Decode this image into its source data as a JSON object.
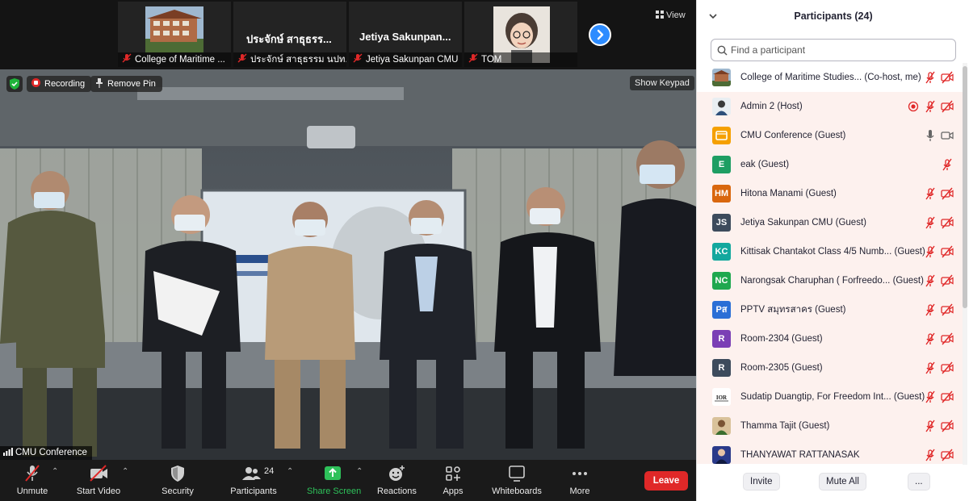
{
  "thumbnails": [
    {
      "name": "",
      "label": "College of Maritime ..."
    },
    {
      "name": "ประจักษ์ สาธุธรร...",
      "label": "ประจักษ์ สาธุธรรม นปท.เ..."
    },
    {
      "name": "Jetiya  Sakunpan...",
      "label": "Jetiya Sakunpan CMU"
    },
    {
      "name": "",
      "label": "TOM"
    }
  ],
  "top_controls": {
    "view_label": "View"
  },
  "overlay": {
    "recording_label": "Recording",
    "remove_pin_label": "Remove Pin",
    "show_keypad_label": "Show Keypad",
    "active_speaker": "CMU Conference"
  },
  "toolbar": {
    "unmute": "Unmute",
    "start_video": "Start Video",
    "security": "Security",
    "participants": "Participants",
    "participants_count": "24",
    "share_screen": "Share Screen",
    "reactions": "Reactions",
    "apps": "Apps",
    "whiteboards": "Whiteboards",
    "more": "More",
    "leave": "Leave"
  },
  "panel": {
    "title": "Participants (24)",
    "search_placeholder": "Find a participant",
    "invite": "Invite",
    "mute_all": "Mute All",
    "more": "..."
  },
  "participants": [
    {
      "name": "College of Maritime Studies...",
      "role": "(Co-host, me)",
      "avatar": "",
      "avatar_color": "#7a5a3a",
      "mic": "muted",
      "video": "off",
      "rec": false
    },
    {
      "name": "Admin 2",
      "role": "(Host)",
      "avatar": "",
      "avatar_color": "#c9d3de",
      "mic": "muted",
      "video": "off",
      "rec": true
    },
    {
      "name": "CMU Conference",
      "role": "(Guest)",
      "avatar": "",
      "avatar_color": "#f5a000",
      "mic": "on",
      "video": "on",
      "rec": false
    },
    {
      "name": "eak",
      "role": "(Guest)",
      "avatar": "E",
      "avatar_color": "#1e9e63",
      "mic": "muted",
      "video": "none",
      "rec": false
    },
    {
      "name": "Hitona Manami",
      "role": "(Guest)",
      "avatar": "HM",
      "avatar_color": "#d9670e",
      "mic": "muted",
      "video": "off",
      "rec": false
    },
    {
      "name": "Jetiya Sakunpan CMU",
      "role": "(Guest)",
      "avatar": "JS",
      "avatar_color": "#3d4b5c",
      "mic": "muted",
      "video": "off",
      "rec": false
    },
    {
      "name": "Kittisak Chantakot Class 4/5 Numb...",
      "role": "(Guest)",
      "avatar": "KC",
      "avatar_color": "#13a89e",
      "mic": "muted",
      "video": "off",
      "rec": false
    },
    {
      "name": "Narongsak Charuphan ( Forfreedo...",
      "role": "(Guest)",
      "avatar": "NC",
      "avatar_color": "#1fa84f",
      "mic": "muted",
      "video": "off",
      "rec": false
    },
    {
      "name": "PPTV สมุทรสาคร",
      "role": "(Guest)",
      "avatar": "Pส",
      "avatar_color": "#2a6fd6",
      "mic": "muted",
      "video": "off",
      "rec": false
    },
    {
      "name": "Room-2304",
      "role": "(Guest)",
      "avatar": "R",
      "avatar_color": "#7b3fb5",
      "mic": "muted",
      "video": "off",
      "rec": false
    },
    {
      "name": "Room-2305",
      "role": "(Guest)",
      "avatar": "R",
      "avatar_color": "#3d4b5c",
      "mic": "muted",
      "video": "off",
      "rec": false
    },
    {
      "name": "Sudatip Duangtip, For Freedom Int...",
      "role": "(Guest)",
      "avatar": "",
      "avatar_color": "#ffffff",
      "mic": "muted",
      "video": "off",
      "rec": false
    },
    {
      "name": "Thamma Tajit",
      "role": "(Guest)",
      "avatar": "",
      "avatar_color": "#8a6a3a",
      "mic": "muted",
      "video": "off",
      "rec": false
    },
    {
      "name": "THANYAWAT RATTANASAK",
      "role": "",
      "avatar": "",
      "avatar_color": "#2a3a8a",
      "mic": "muted",
      "video": "off",
      "rec": false
    }
  ],
  "colors": {
    "accent_blue": "#2d8cff",
    "leave_red": "#e02828",
    "share_green": "#2ec15a",
    "mute_red": "#e02828"
  }
}
